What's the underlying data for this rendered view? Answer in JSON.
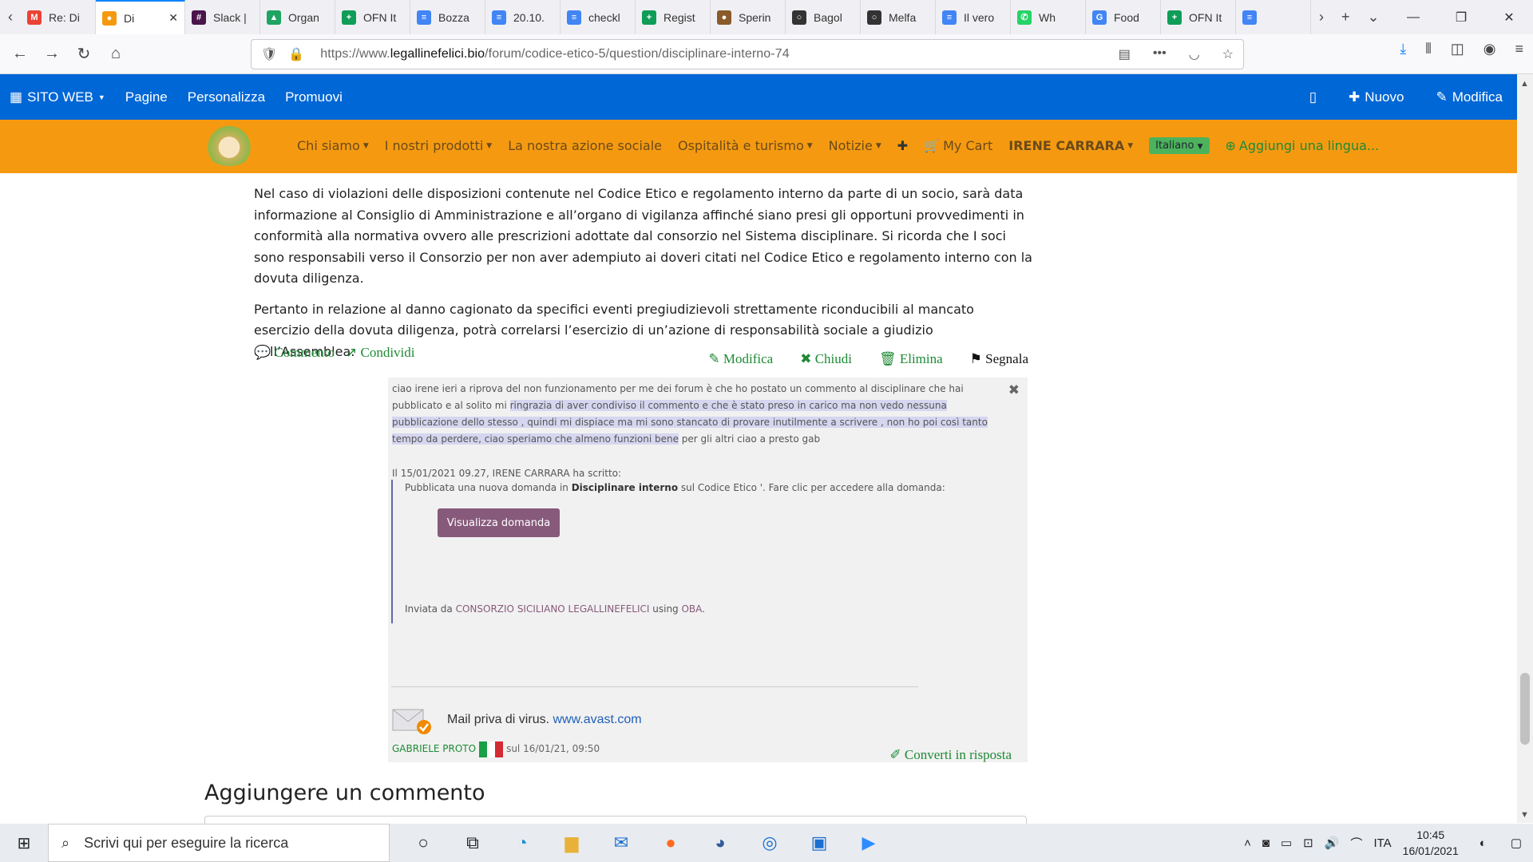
{
  "browser": {
    "tabs": [
      {
        "label": "Re: Di",
        "icon": "gmail-icon",
        "color": "#ea4335",
        "glyph": "M"
      },
      {
        "label": "Di",
        "icon": "chicken-icon",
        "color": "#f59a10",
        "glyph": "●",
        "active": true
      },
      {
        "label": "Slack |",
        "icon": "slack-icon",
        "color": "#4a154b",
        "glyph": "#"
      },
      {
        "label": "Organ",
        "icon": "drive-icon",
        "color": "#1fa463",
        "glyph": "▲"
      },
      {
        "label": "OFN It",
        "icon": "sheets-icon",
        "color": "#0f9d58",
        "glyph": "+"
      },
      {
        "label": "Bozza",
        "icon": "docs-icon",
        "color": "#4285f4",
        "glyph": "≡"
      },
      {
        "label": "20.10.",
        "icon": "docs-icon",
        "color": "#4285f4",
        "glyph": "≡"
      },
      {
        "label": "checkl",
        "icon": "docs-icon",
        "color": "#4285f4",
        "glyph": "≡"
      },
      {
        "label": "Regist",
        "icon": "sheets-icon",
        "color": "#0f9d58",
        "glyph": "+"
      },
      {
        "label": "Sperin",
        "icon": "site-icon",
        "color": "#8a5a2a",
        "glyph": "●"
      },
      {
        "label": "Bagol",
        "icon": "circle-icon",
        "color": "#333",
        "glyph": "○"
      },
      {
        "label": "Melfa",
        "icon": "circle-icon",
        "color": "#333",
        "glyph": "○"
      },
      {
        "label": "Il vero",
        "icon": "docs-icon",
        "color": "#4285f4",
        "glyph": "≡"
      },
      {
        "label": "Wh",
        "icon": "whatsapp-icon",
        "color": "#25d366",
        "glyph": "✆"
      },
      {
        "label": "Food",
        "icon": "google-icon",
        "color": "#4285f4",
        "glyph": "G"
      },
      {
        "label": "OFN It",
        "icon": "sheets-icon",
        "color": "#0f9d58",
        "glyph": "+"
      },
      {
        "label": "",
        "icon": "docs-icon",
        "color": "#4285f4",
        "glyph": "≡"
      }
    ],
    "url_prefix": "https://www.",
    "url_domain": "legallinefelici.bio",
    "url_path": "/forum/codice-etico-5/question/disciplinare-interno-74"
  },
  "odoo_bar": {
    "site_web": "SITO WEB",
    "pagine": "Pagine",
    "personalizza": "Personalizza",
    "promuovi": "Promuovi",
    "nuovo": "Nuovo",
    "modifica": "Modifica"
  },
  "site_menu": {
    "chi_siamo": "Chi siamo",
    "prodotti": "I nostri prodotti",
    "azione": "La nostra azione sociale",
    "ospitalita": "Ospitalità e turismo",
    "notizie": "Notizie",
    "plus": "✚",
    "cart": "My Cart",
    "user": "IRENE CARRARA",
    "lang": "Italiano",
    "add_lang": "Aggiungi una lingua..."
  },
  "post": {
    "p1": "Nel caso di violazioni delle disposizioni contenute nel Codice Etico e regolamento interno da parte di un socio, sarà data informazione al Consiglio di Amministrazione e all’organo di vigilanza affinché siano presi gli opportuni provvedimenti in conformità alla normativa ovvero alle prescrizioni adottate dal consorzio nel Sistema disciplinare. Si ricorda che I soci sono responsabili verso il Consorzio per non aver adempiuto ai doveri citati nel Codice Etico e regolamento interno con la dovuta diligenza.",
    "p2": "Pertanto in relazione al danno cagionato da specifici eventi pregiudizievoli strettamente riconducibili al mancato esercizio della dovuta diligenza, potrà correlarsi l’esercizio di un’azione di responsabilità sociale a giudizio dell’Assemblea.",
    "commento": "Commento",
    "condividi": "Condividi",
    "modifica": "Modifica",
    "chiudi": "Chiudi",
    "elimina": "Elimina",
    "segnala": "Segnala"
  },
  "comment": {
    "text_a": "ciao irene ieri a riprova del non funzionamento per me dei forum è che ho postato un commento al disciplinare che hai pubblicato e al solito mi ",
    "text_hl": "ringrazia di aver condiviso il commento e che è stato preso in carico ma non vedo nessuna pubblicazione dello stesso , quindi mi dispiace ma mi sono stancato di provare inutilmente a scrivere , non ho poi così tanto tempo da perdere, ciao speriamo che almeno funzioni bene",
    "text_b": " per gli altri ciao a presto gab",
    "quote_header": "Il 15/01/2021 09.27, IRENE CARRARA ha scritto:",
    "quote_pre": "Pubblicata una nuova domanda in ",
    "quote_bold": "Disciplinare interno",
    "quote_post": " sul Codice Etico '. Fare clic per accedere alla domanda:",
    "view_button": "Visualizza domanda",
    "sent_pre": "Inviata da ",
    "sent_link": "CONSORZIO SICILIANO LEGALLINEFELICI",
    "sent_mid": " using ",
    "sent_oba": "OBA",
    "sent_end": ".",
    "avast_text": "Mail priva di virus. ",
    "avast_link": "www.avast.com",
    "author": "GABRIELE PROTO",
    "date": "sul 16/01/21, 09:50",
    "convert": "Converti in risposta"
  },
  "add_comment_title": "Aggiungere un commento",
  "taskbar": {
    "search_placeholder": "Scrivi qui per eseguire la ricerca",
    "lang": "ITA",
    "time": "10:45",
    "date": "16/01/2021"
  }
}
